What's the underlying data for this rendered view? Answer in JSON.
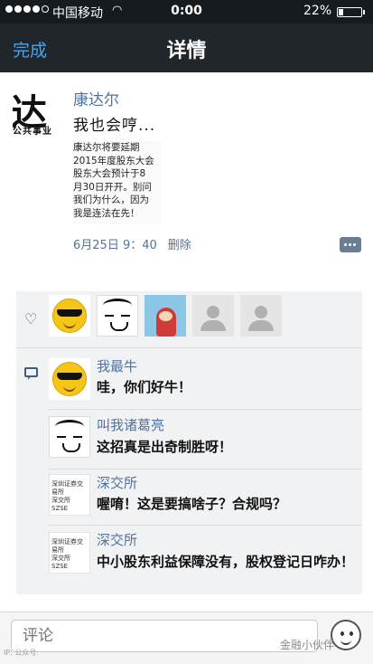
{
  "status": {
    "carrier": "中国移动",
    "time": "0:00",
    "battery_text": "22%",
    "battery_level": 0.22,
    "signal_bars_filled": 4,
    "signal_bars_total": 5
  },
  "nav": {
    "done_label": "完成",
    "title": "详情"
  },
  "post": {
    "avatar_text_big": "达尔",
    "avatar_text_small": "公共事业",
    "author": "康达尔",
    "text": "我也会哼...",
    "image_lines": [
      "康达尔将要延期",
      "2015年度股东大会",
      "股东大会预计于8",
      "月30日开开。别问",
      "我们为什么，因为",
      "我是连法在先！"
    ],
    "date": "6月25日 9：40",
    "delete_label": "删除"
  },
  "likes": {
    "count_avatars": 5
  },
  "comments": [
    {
      "name": "我最牛",
      "text": "哇，你们好牛！",
      "avatar": "sunglasses-emoji-avatar"
    },
    {
      "name": "叫我诸葛亮",
      "text": "这招真是出奇制胜呀！",
      "avatar": "sketch-avatar"
    },
    {
      "name": "深交所",
      "text": "喔唷！这是要搞啥子？合规吗？",
      "avatar": "szse-avatar"
    },
    {
      "name": "深交所",
      "text": "中小股东利益保障没有，股权登记日咋办！",
      "avatar": "szse-avatar"
    }
  ],
  "doc_avatar_lines": [
    "深圳证券交易所",
    "深交所",
    "SZSE"
  ],
  "input": {
    "placeholder": "评论"
  },
  "watermark": {
    "left": "IP: 公众号:",
    "right": "金融小伙伴"
  },
  "icons": {
    "signal": "signal-dots-icon",
    "wifi": "wifi-icon",
    "battery": "battery-icon",
    "heart": "heart-icon",
    "comment": "comment-bubble-icon",
    "more": "more-dots-icon",
    "emoji": "smiley-icon"
  },
  "colors": {
    "link_blue": "#52729c",
    "nav_bg": "#21262b",
    "done_blue": "#4ba3e6"
  }
}
